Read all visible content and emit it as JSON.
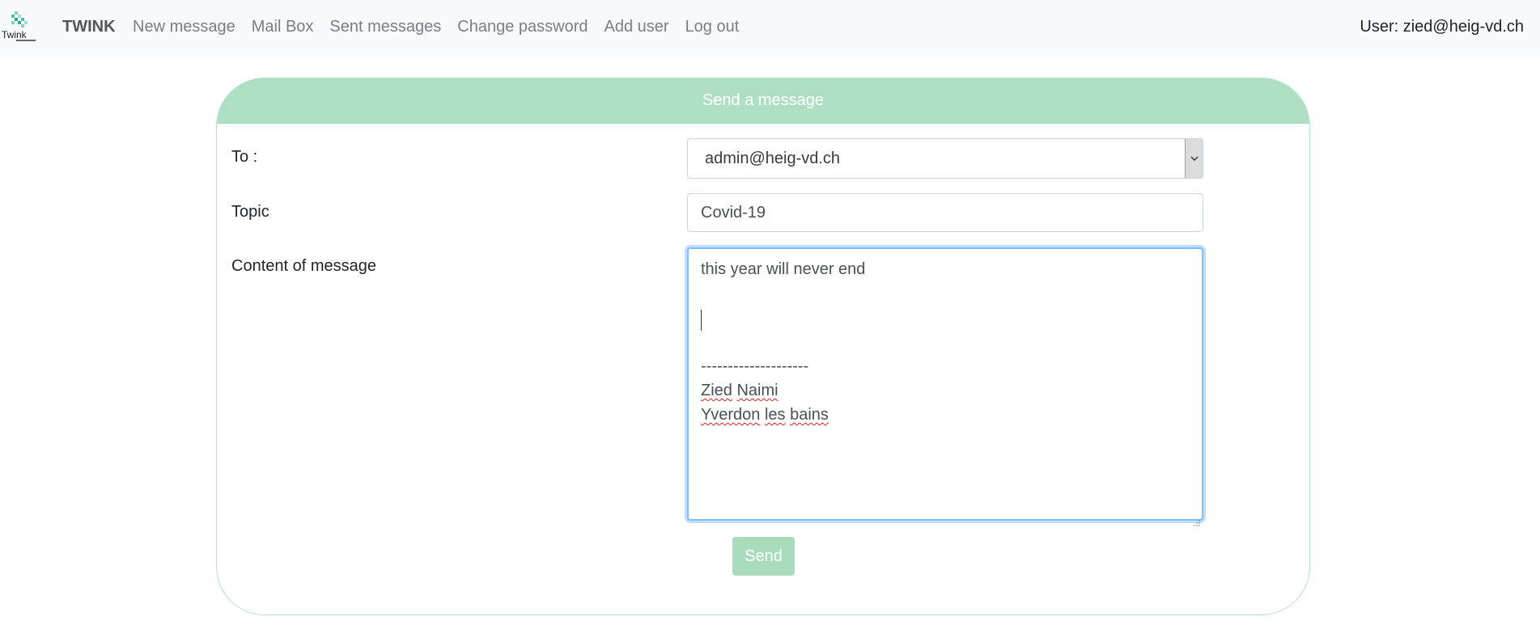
{
  "navbar": {
    "logo_text": "Twink",
    "brand": "TWINK",
    "links": [
      "New message",
      "Mail Box",
      "Sent messages",
      "Change password",
      "Add user",
      "Log out"
    ],
    "user": "User: zied@heig-vd.ch"
  },
  "form": {
    "title": "Send a message",
    "to_label": "To :",
    "to_value": "admin@heig-vd.ch",
    "topic_label": "Topic",
    "topic_value": "Covid-19",
    "content_label": "Content of message",
    "content_lines": {
      "line1": "this year will never end",
      "separator": "--------------------",
      "name_first": "Zied",
      "name_last": "Naimi",
      "city_first": "Yverdon",
      "city_mid": "les",
      "city_last": "bains"
    },
    "send_label": "Send"
  },
  "colors": {
    "header_bg": "#afdfc3",
    "send_bg": "#a8dcbd",
    "focus_border": "#80bdff"
  },
  "icons": {
    "select_arrow": "chevron-down-icon",
    "logo": "twink-logo-icon"
  }
}
